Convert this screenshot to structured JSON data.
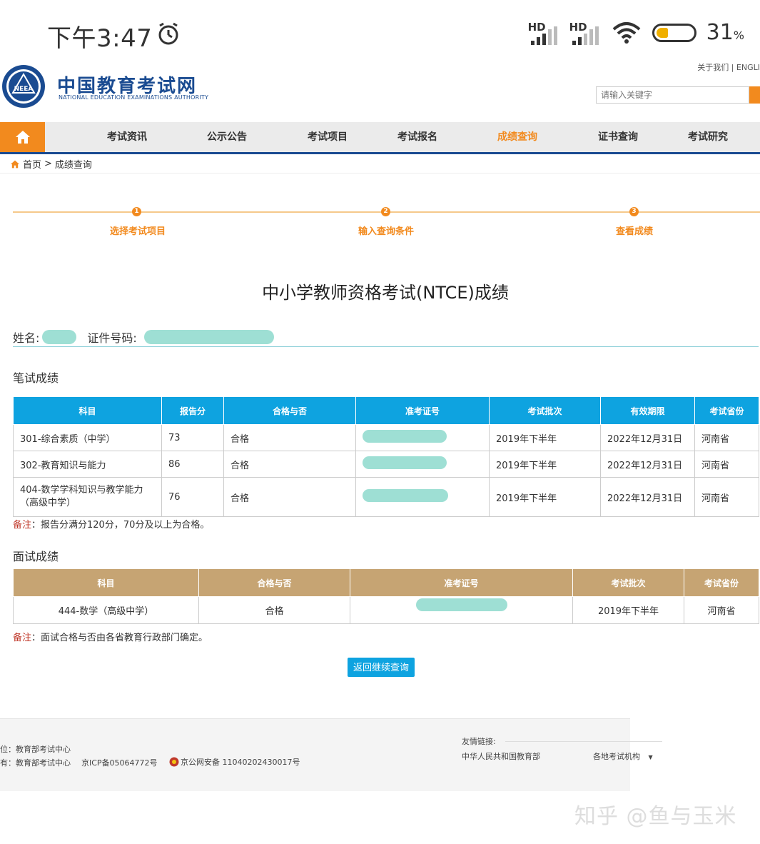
{
  "status_bar": {
    "time": "下午3:47",
    "signal1": "HD",
    "signal2": "HD",
    "battery": "31",
    "battery_unit": "%"
  },
  "header": {
    "logo_title": "中国教育考试网",
    "logo_sub": "NATIONAL EDUCATION EXAMINATIONS AUTHORITY",
    "logo_mark": "NEEA",
    "top_links": "关于我们 | ENGLI",
    "search_placeholder": "请输入关键字"
  },
  "nav": {
    "items": [
      "考试资讯",
      "公示公告",
      "考试项目",
      "考试报名",
      "成绩查询",
      "证书查询",
      "考试研究"
    ],
    "active": "成绩查询"
  },
  "breadcrumb": {
    "home": "首页",
    "sep": ">",
    "current": "成绩查询"
  },
  "steps": [
    {
      "num": "1",
      "label": "选择考试项目"
    },
    {
      "num": "2",
      "label": "输入查询条件"
    },
    {
      "num": "3",
      "label": "查看成绩"
    }
  ],
  "page_title": "中小学教师资格考试(NTCE)成绩",
  "candidate": {
    "name_label": "姓名:",
    "id_label": "证件号码:"
  },
  "written": {
    "title": "笔试成绩",
    "headers": [
      "科目",
      "报告分",
      "合格与否",
      "准考证号",
      "考试批次",
      "有效期限",
      "考试省份"
    ],
    "rows": [
      {
        "subject": "301-综合素质（中学）",
        "score": "73",
        "pass": "合格",
        "batch": "2019年下半年",
        "valid": "2022年12月31日",
        "province": "河南省"
      },
      {
        "subject": "302-教育知识与能力",
        "score": "86",
        "pass": "合格",
        "batch": "2019年下半年",
        "valid": "2022年12月31日",
        "province": "河南省"
      },
      {
        "subject": "404-数学学科知识与教学能力（高级中学）",
        "score": "76",
        "pass": "合格",
        "batch": "2019年下半年",
        "valid": "2022年12月31日",
        "province": "河南省"
      }
    ],
    "note_label": "备注",
    "note_text": "：报告分满分120分，70分及以上为合格。"
  },
  "interview": {
    "title": "面试成绩",
    "headers": [
      "科目",
      "合格与否",
      "准考证号",
      "考试批次",
      "考试省份"
    ],
    "rows": [
      {
        "subject": "444-数学（高级中学）",
        "pass": "合格",
        "batch": "2019年下半年",
        "province": "河南省"
      }
    ],
    "note_label": "备注",
    "note_text": "：面试合格与否由各省教育行政部门确定。"
  },
  "back_button": "返回继续查询",
  "footer": {
    "line1": "位：教育部考试中心",
    "line2": "有：教育部考试中心",
    "icp": "京ICP备05064772号",
    "police": "京公网安备 11040202430017号",
    "friend_links": "友情链接:",
    "moe": "中华人民共和国教育部",
    "local": "各地考试机构",
    "local_arrow": "▼"
  },
  "watermark": "知乎 @鱼与玉米",
  "colors": {
    "accent_orange": "#f28a1e",
    "brand_blue": "#1a4b91",
    "table_blue": "#0ea3e0",
    "table_tan": "#c6a473"
  }
}
